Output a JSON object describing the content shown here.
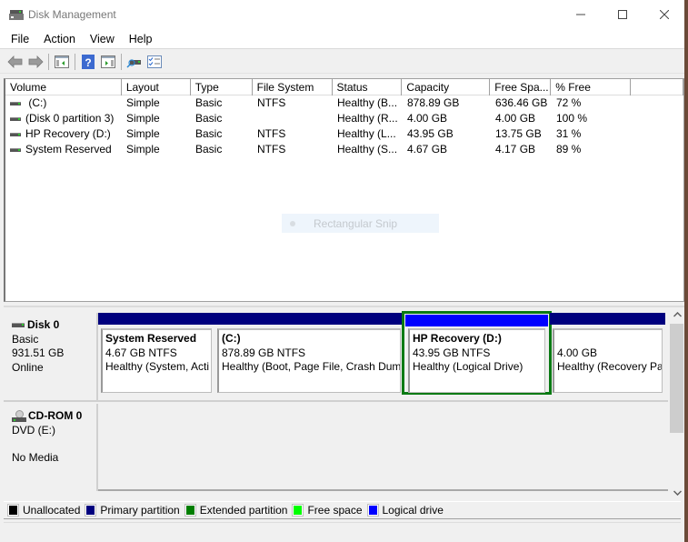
{
  "window": {
    "title": "Disk Management",
    "controls": {
      "minimize": "—",
      "maximize": "☐",
      "close": "✕"
    }
  },
  "menu": [
    "File",
    "Action",
    "View",
    "Help"
  ],
  "toolbar": {
    "buttons": [
      "back-icon",
      "forward-icon",
      "show-hide-console-tree-icon",
      "help-icon",
      "show-hide-action-pane-icon",
      "connect-disk-icon",
      "properties-icon"
    ]
  },
  "volume_list": {
    "columns": [
      "Volume",
      "Layout",
      "Type",
      "File System",
      "Status",
      "Capacity",
      "Free Spa...",
      "% Free",
      ""
    ],
    "rows": [
      {
        "volume": " (C:)",
        "layout": "Simple",
        "type": "Basic",
        "fs": "NTFS",
        "status": "Healthy (B...",
        "capacity": "878.89 GB",
        "free": "636.46 GB",
        "pct": "72 %"
      },
      {
        "volume": "(Disk 0 partition 3)",
        "layout": "Simple",
        "type": "Basic",
        "fs": "",
        "status": "Healthy (R...",
        "capacity": "4.00 GB",
        "free": "4.00 GB",
        "pct": "100 %"
      },
      {
        "volume": "HP Recovery (D:)",
        "layout": "Simple",
        "type": "Basic",
        "fs": "NTFS",
        "status": "Healthy (L...",
        "capacity": "43.95 GB",
        "free": "13.75 GB",
        "pct": "31 %"
      },
      {
        "volume": "System Reserved",
        "layout": "Simple",
        "type": "Basic",
        "fs": "NTFS",
        "status": "Healthy (S...",
        "capacity": "4.67 GB",
        "free": "4.17 GB",
        "pct": "89 %"
      }
    ]
  },
  "snip_overlay": {
    "label": "Rectangular Snip"
  },
  "disks": [
    {
      "name": "Disk 0",
      "type": "Basic",
      "size": "931.51 GB",
      "status": "Online",
      "partitions": [
        {
          "name": "System Reserved",
          "size": "4.67 GB NTFS",
          "status": "Healthy (System, Acti",
          "kind": "primary",
          "selected": false
        },
        {
          "name": " (C:)",
          "size": "878.89 GB NTFS",
          "status": "Healthy (Boot, Page File, Crash Dum",
          "kind": "primary",
          "selected": false
        },
        {
          "name": "HP Recovery  (D:)",
          "size": "43.95 GB NTFS",
          "status": "Healthy (Logical Drive)",
          "kind": "logical",
          "selected": true
        },
        {
          "name": "",
          "size": "4.00 GB",
          "status": "Healthy (Recovery Pa",
          "kind": "primary",
          "selected": false
        }
      ]
    },
    {
      "name": "CD-ROM 0",
      "type": "DVD (E:)",
      "size": "",
      "status": "No Media"
    }
  ],
  "legend": [
    {
      "label": "Unallocated",
      "color": "#000000"
    },
    {
      "label": "Primary partition",
      "color": "#00007e"
    },
    {
      "label": "Extended partition",
      "color": "#007e00"
    },
    {
      "label": "Free space",
      "color": "#00ff00"
    },
    {
      "label": "Logical drive",
      "color": "#0000ff"
    }
  ],
  "colors": {
    "primary": "#00007e",
    "logical": "#0000ff",
    "selection": "#0a7a14"
  }
}
